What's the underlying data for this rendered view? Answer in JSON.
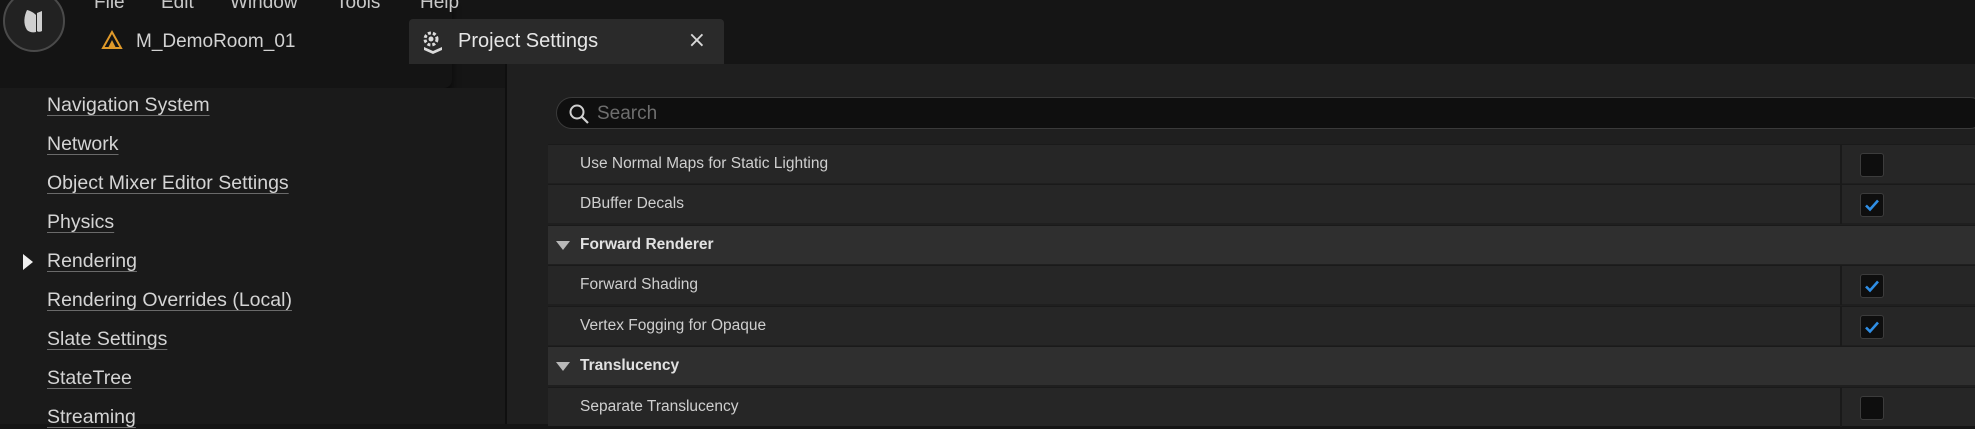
{
  "menubar": {
    "items": [
      "File",
      "Edit",
      "Window",
      "Tools",
      "Help"
    ]
  },
  "tabs": {
    "asset": {
      "label": "M_DemoRoom_01",
      "icon": "material-icon"
    },
    "settings": {
      "label": "Project Settings",
      "icon": "settings-gear-icon",
      "close": "×"
    }
  },
  "sidebar": {
    "items": [
      {
        "label": "Navigation System"
      },
      {
        "label": "Network"
      },
      {
        "label": "Object Mixer Editor Settings"
      },
      {
        "label": "Physics"
      },
      {
        "label": "Rendering",
        "selected": true
      },
      {
        "label": "Rendering Overrides (Local)"
      },
      {
        "label": "Slate Settings"
      },
      {
        "label": "StateTree"
      },
      {
        "label": "Streaming"
      }
    ]
  },
  "search": {
    "placeholder": "Search",
    "value": ""
  },
  "properties": [
    {
      "type": "property",
      "label": "Use Normal Maps for Static Lighting",
      "checked": false
    },
    {
      "type": "property",
      "label": "DBuffer Decals",
      "checked": true
    },
    {
      "type": "category",
      "label": "Forward Renderer"
    },
    {
      "type": "property",
      "label": "Forward Shading",
      "checked": true
    },
    {
      "type": "property",
      "label": "Vertex Fogging for Opaque",
      "checked": true
    },
    {
      "type": "category",
      "label": "Translucency"
    },
    {
      "type": "property",
      "label": "Separate Translucency",
      "checked": false
    }
  ],
  "colors": {
    "accent": "#2f8ee5",
    "background": "#151515",
    "panel": "#1f1f1f"
  }
}
